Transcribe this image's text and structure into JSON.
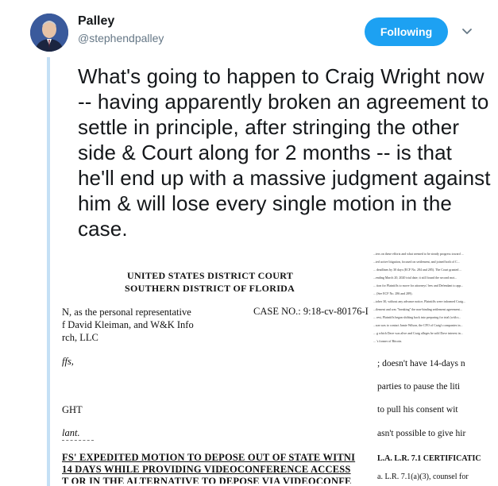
{
  "author": {
    "display_name": "Palley",
    "handle": "@stephendpalley",
    "follow_label": "Following"
  },
  "tweet": {
    "text": "What's going to happen to Craig Wright now -- having apparently broken an agreement to settle in principle, after stringing the other side & Court along for 2 months -- is that he'll end up with a massive judgment against him & will lose every single motion in the case."
  },
  "icons": {
    "avatar": "avatar-photo",
    "caret": "chevron-down-icon"
  },
  "colors": {
    "accent": "#1da1f2",
    "thread_line": "#c4e0f5"
  },
  "document": {
    "court_line1": "UNITED STATES DISTRICT COURT",
    "court_line2": "SOUTHERN DISTRICT OF FLORIDA",
    "party_line1": "N, as the personal representative",
    "party_line2": "f David Kleiman, and W&K Info",
    "party_line3": "rch, LLC",
    "case_no": "CASE NO.:  9:18-cv-80176-I",
    "frag_ffs": "ffs,",
    "frag_ght": "GHT",
    "frag_ant": "lant.",
    "motion_line1": "FS' EXPEDITED MOTION TO DEPOSE OUT OF STATE WITNI",
    "motion_line2": "14 DAYS WHILE PROVIDING VIDEOCONFERENCE ACCESS",
    "motion_line3": "T OR IN THE ALTERNATIVE TO DEPOSE VIA VIDEOCONFE"
  },
  "document_right": {
    "tiny_lines": [
      "...ters on these efforts and what seemed to be steady progress toward ...",
      "...ted active litigation, focused on settlement, and joined both of C...",
      "... deadlines by 30 days (ECF No. 284 and 285). The Court granted ...",
      "...ending March 20, 2020 trial date; it still found the second mot...",
      "... tion for Plaintiffs to move for attorneys' fees and Defendant to app...",
      "... (See ECF No. 286 and 289).",
      "...tober 30, without any advance notice, Plaintiffs were informed Craig...",
      "...tlement and was \"breaking\" the non-binding settlement agreement...",
      "... rest, Plaintiffs began shifting back into preparing for trial (with s...",
      "...son was to contact Jamie Wilson, the CFO of Craig's companies in...",
      "... g which Dave was alive and Craig alleges he sold Dave interest in...",
      "... 's former of Bitcoin."
    ],
    "line_a": "; doesn't have 14-days n",
    "line_b": "parties to pause the liti",
    "line_c": "to pull his consent wit",
    "line_d": "asn't possible to give hir",
    "line_e": "L.A. L.R. 7.1 CERTIFICATIC",
    "line_f": "a. L.R. 7.1(a)(3), counsel for"
  }
}
